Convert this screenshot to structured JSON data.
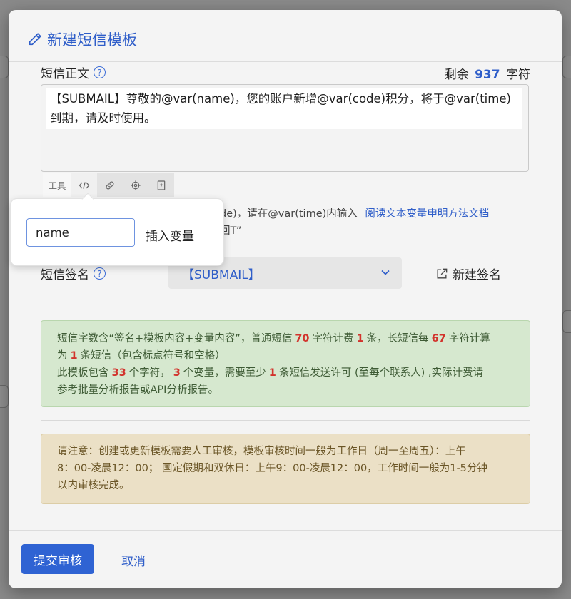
{
  "modal": {
    "title": "新建短信模板"
  },
  "content_field": {
    "label": "短信正文",
    "remaining_prefix": "剩余",
    "remaining_count": "937",
    "remaining_suffix": "字符",
    "text": "【SUBMAIL】尊敬的@var(name)，您的账户新增@var(code)积分，将于@var(time)到期，请及时使用。"
  },
  "toolbar": {
    "tools_label": "工具",
    "icons": [
      "code-icon",
      "link-icon",
      "target-icon",
      "bookmark-plus-icon"
    ]
  },
  "variable_popover": {
    "input_value": "name",
    "insert_label": "插入变量"
  },
  "hint": {
    "line1_text": "de)，请在@var(time)内输入",
    "line1_link": "阅读文本变量申明方法文档",
    "line2_text": "回T”"
  },
  "signature": {
    "label": "短信签名",
    "selected": "【SUBMAIL】",
    "new_label": "新建签名"
  },
  "billing_note": {
    "l1_a": "短信字数含“签名+模板内容+变量内容”，普通短信",
    "l1_n1": "70",
    "l1_b": "字符计费",
    "l1_n2": "1",
    "l1_c": "条，长短信每",
    "l1_n3": "67",
    "l1_d": "字符计算",
    "l2_a": "为",
    "l2_n1": "1",
    "l2_b": "条短信（包含标点符号和空格）",
    "l3_a": "此模板包含",
    "l3_n1": "33",
    "l3_b": "个字符，",
    "l3_n2": "3",
    "l3_c": "个变量，需要至少",
    "l3_n3": "1",
    "l3_d": "条短信发送许可 (至每个联系人) ,实际计费请",
    "l4": "参考批量分析报告或API分析报告。"
  },
  "review_note": {
    "line1": "请注意：创建或更新模板需要人工审核，模板审核时间一般为工作日（周一至周五）：上午",
    "line2": "8：00-凌晨12：00； 国定假期和双休日：上午9：00-凌晨12：00，工作时间一般为1-5分钟",
    "line3": "以内审核完成。"
  },
  "footer": {
    "submit_label": "提交审核",
    "cancel_label": "取消"
  },
  "colors": {
    "accent": "#2f5ec9",
    "primary_button": "#2f63d3",
    "success_bg": "#d6e8cf",
    "warning_bg": "#ebe0c6",
    "highlight_number": "#d2332c"
  }
}
